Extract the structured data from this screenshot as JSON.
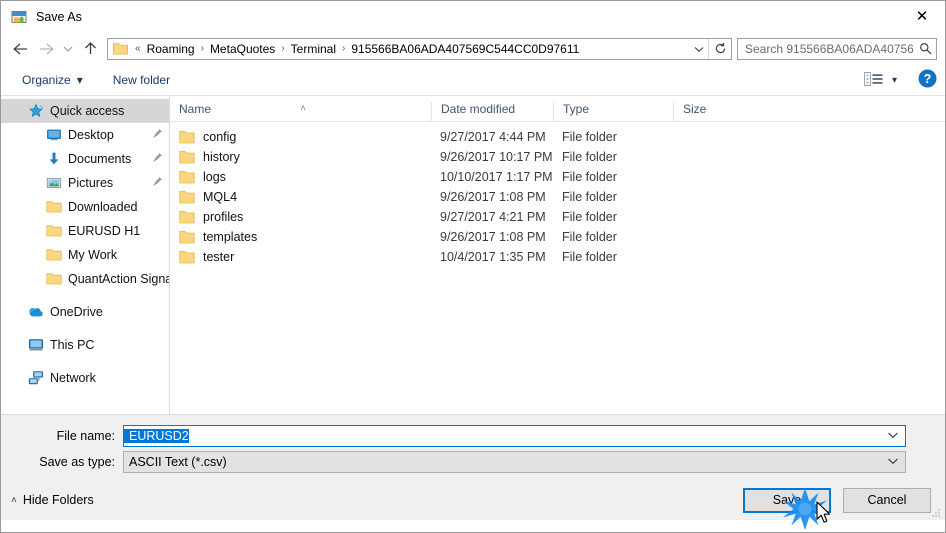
{
  "window": {
    "title": "Save As",
    "app_icon": "save-as-icon",
    "close_label": "✕"
  },
  "navigation": {
    "back_icon": "arrow-left-icon",
    "forward_icon": "arrow-right-icon",
    "recent_icon": "chevron-down-icon",
    "up_icon": "arrow-up-icon",
    "address": {
      "folder_icon": "folder-icon",
      "prefix": "«",
      "crumbs": [
        "Roaming",
        "MetaQuotes",
        "Terminal",
        "915566BA06ADA407569C544CC0D97611"
      ],
      "separator": "›",
      "dropdown_icon": "chevron-down-icon",
      "refresh_icon": "refresh-icon"
    },
    "search": {
      "placeholder": "Search 915566BA06ADA40756...",
      "icon": "search-icon"
    }
  },
  "toolbar": {
    "organize_label": "Organize",
    "organize_caret": "▾",
    "new_folder_label": "New folder",
    "view_icon": "view-options-icon",
    "view_caret": "▾",
    "help_icon": "help-icon",
    "help_label": "?"
  },
  "sidebar": {
    "items": [
      {
        "label": "Quick access",
        "icon": "star-icon",
        "level": 0,
        "selected": true,
        "pinned": false
      },
      {
        "label": "Desktop",
        "icon": "desktop-icon",
        "level": 1,
        "selected": false,
        "pinned": true
      },
      {
        "label": "Documents",
        "icon": "documents-download-icon",
        "level": 1,
        "selected": false,
        "pinned": true
      },
      {
        "label": "Pictures",
        "icon": "pictures-icon",
        "level": 1,
        "selected": false,
        "pinned": true
      },
      {
        "label": "Downloaded",
        "icon": "folder-icon",
        "level": 1,
        "selected": false,
        "pinned": false
      },
      {
        "label": "EURUSD H1",
        "icon": "folder-icon",
        "level": 1,
        "selected": false,
        "pinned": false
      },
      {
        "label": "My Work",
        "icon": "folder-icon",
        "level": 1,
        "selected": false,
        "pinned": false
      },
      {
        "label": "QuantAction Signal",
        "icon": "folder-icon",
        "level": 1,
        "selected": false,
        "pinned": false
      },
      {
        "label": "OneDrive",
        "icon": "onedrive-cloud-icon",
        "level": 0,
        "selected": false,
        "pinned": false,
        "gap_before": true
      },
      {
        "label": "This PC",
        "icon": "this-pc-icon",
        "level": 0,
        "selected": false,
        "pinned": false,
        "gap_before": true
      },
      {
        "label": "Network",
        "icon": "network-icon",
        "level": 0,
        "selected": false,
        "pinned": false,
        "gap_before": true
      }
    ]
  },
  "filelist": {
    "columns": [
      {
        "label": "Name",
        "sorted": "asc",
        "sort_caret": "˄"
      },
      {
        "label": "Date modified",
        "sorted": "",
        "sort_caret": ""
      },
      {
        "label": "Type",
        "sorted": "",
        "sort_caret": ""
      },
      {
        "label": "Size",
        "sorted": "",
        "sort_caret": ""
      }
    ],
    "rows": [
      {
        "name": "config",
        "date": "9/27/2017 4:44 PM",
        "type": "File folder",
        "size": "",
        "icon": "folder-icon"
      },
      {
        "name": "history",
        "date": "9/26/2017 10:17 PM",
        "type": "File folder",
        "size": "",
        "icon": "folder-icon"
      },
      {
        "name": "logs",
        "date": "10/10/2017 1:17 PM",
        "type": "File folder",
        "size": "",
        "icon": "folder-icon"
      },
      {
        "name": "MQL4",
        "date": "9/26/2017 1:08 PM",
        "type": "File folder",
        "size": "",
        "icon": "folder-icon"
      },
      {
        "name": "profiles",
        "date": "9/27/2017 4:21 PM",
        "type": "File folder",
        "size": "",
        "icon": "folder-icon"
      },
      {
        "name": "templates",
        "date": "9/26/2017 1:08 PM",
        "type": "File folder",
        "size": "",
        "icon": "folder-icon"
      },
      {
        "name": "tester",
        "date": "10/4/2017 1:35 PM",
        "type": "File folder",
        "size": "",
        "icon": "folder-icon"
      }
    ]
  },
  "form": {
    "filename_label": "File name:",
    "filename_value": "EURUSD2",
    "filename_dropdown_icon": "chevron-down-icon",
    "filetype_label": "Save as type:",
    "filetype_value": "ASCII Text (*.csv)",
    "filetype_dropdown_icon": "chevron-down-icon"
  },
  "footer": {
    "hide_folders_label": "Hide Folders",
    "hide_folders_caret": "˄",
    "save_label": "Save",
    "cancel_label": "Cancel",
    "resize_grip_icon": "resize-grip-icon"
  },
  "colors": {
    "accent": "#0078d7",
    "selection": "#0078d7",
    "folder_yellow": "#fcd77f",
    "sidebar_selected": "#d6d6d6",
    "header_text": "#44546f"
  }
}
